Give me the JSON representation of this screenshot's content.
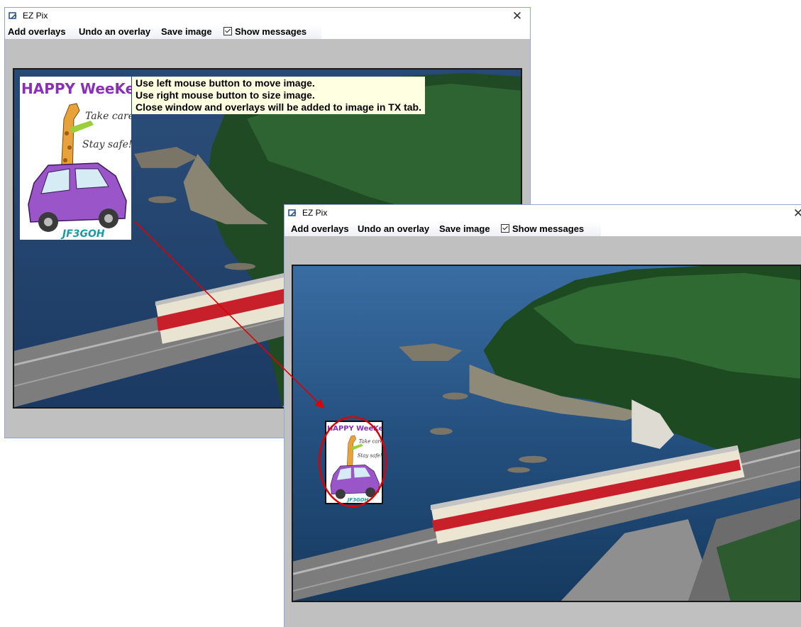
{
  "windows": [
    {
      "title": "EZ Pix",
      "close_glyph": "✕",
      "menu": {
        "add_overlays": "Add overlays",
        "undo_overlay": "Undo an overlay",
        "save_image": "Save image",
        "show_messages": "Show messages",
        "show_messages_checked": true
      },
      "messages": [
        "Use left mouse button to move image.",
        "Use right mouse button to size image.",
        "Close window and overlays will be added to image in TX tab."
      ]
    },
    {
      "title": "EZ Pix",
      "close_glyph": "✕",
      "menu": {
        "add_overlays": "Add overlays",
        "undo_overlay": "Undo an overlay",
        "save_image": "Save image",
        "show_messages": "Show messages",
        "show_messages_checked": true
      }
    }
  ],
  "overlay": {
    "banner": "HAPPY WeeKend!",
    "line1": "Take care",
    "line2": "Stay safe!",
    "callsign": "JF3GOH"
  },
  "colors": {
    "highlight_ring": "#e00000",
    "arrow": "#e00000",
    "client_bg": "#c0c0c0",
    "message_bg": "#ffffe1",
    "banner_purple": "#8a2fb8",
    "callsign_teal": "#1a9aa8"
  },
  "icons": [
    "ezpix-app-icon",
    "close-icon",
    "checkbox-icon",
    "arrow-annotation"
  ]
}
